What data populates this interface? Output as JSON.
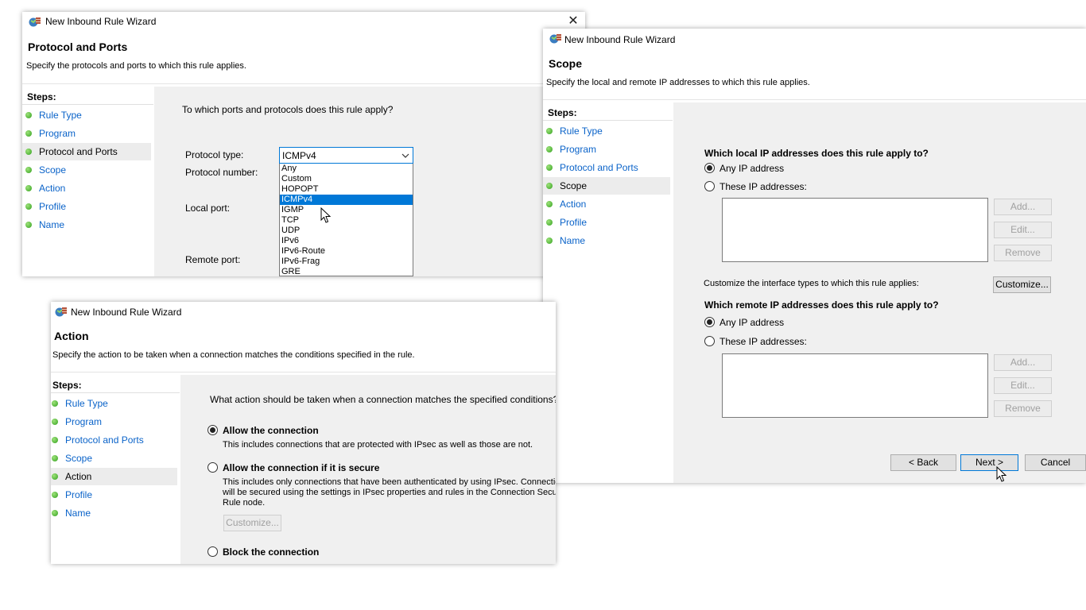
{
  "window_title": "New Inbound Rule Wizard",
  "steps_heading": "Steps:",
  "steps": [
    "Rule Type",
    "Program",
    "Protocol and Ports",
    "Scope",
    "Action",
    "Profile",
    "Name"
  ],
  "protocol_window": {
    "header_title": "Protocol and Ports",
    "header_subtitle": "Specify the protocols and ports to which this rule applies.",
    "question": "To which ports and protocols does this rule apply?",
    "protocol_type_label": "Protocol type:",
    "protocol_number_label": "Protocol number:",
    "local_port_label": "Local port:",
    "remote_port_label": "Remote port:",
    "protocol_type_value": "ICMPv4",
    "dropdown_options": [
      "Any",
      "Custom",
      "HOPOPT",
      "ICMPv4",
      "IGMP",
      "TCP",
      "UDP",
      "IPv6",
      "IPv6-Route",
      "IPv6-Frag",
      "GRE"
    ],
    "selected_option": "ICMPv4"
  },
  "scope_window": {
    "header_title": "Scope",
    "header_subtitle": "Specify the local and remote IP addresses to which this rule applies.",
    "local_question": "Which local IP addresses does this rule apply to?",
    "remote_question": "Which remote IP addresses does this rule apply to?",
    "any_ip_label": "Any IP address",
    "these_ip_label": "These IP addresses:",
    "add_label": "Add...",
    "edit_label": "Edit...",
    "remove_label": "Remove",
    "customize_text": "Customize the interface types to which this rule applies:",
    "customize_label": "Customize...",
    "back_label": "< Back",
    "next_label": "Next >",
    "cancel_label": "Cancel"
  },
  "action_window": {
    "header_title": "Action",
    "header_subtitle": "Specify the action to be taken when a connection matches the conditions specified in the rule.",
    "question": "What action should be taken when a connection matches the specified conditions?",
    "allow_label": "Allow the connection",
    "allow_desc": "This includes connections that are protected with IPsec as well as those are not.",
    "secure_label": "Allow the connection if it is secure",
    "secure_desc_1": "This includes only connections that have been authenticated by using IPsec.  Connection",
    "secure_desc_2": "will be secured using the settings in IPsec properties and rules in the Connection Security",
    "secure_desc_3": "Rule node.",
    "customize_label": "Customize...",
    "block_label": "Block the connection"
  },
  "icons": {
    "app_icon": "firewall-wizard-icon",
    "close_icon": "close-icon",
    "dropdown_arrow": "chevron-down-icon",
    "cursor": "mouse-pointer-icon",
    "step_bullet": "green-dot-icon"
  },
  "colors": {
    "link_blue": "#0a63c9",
    "selection_blue": "#0078d7",
    "step_green": "#33a11f",
    "content_bg": "#f0f0f0"
  }
}
